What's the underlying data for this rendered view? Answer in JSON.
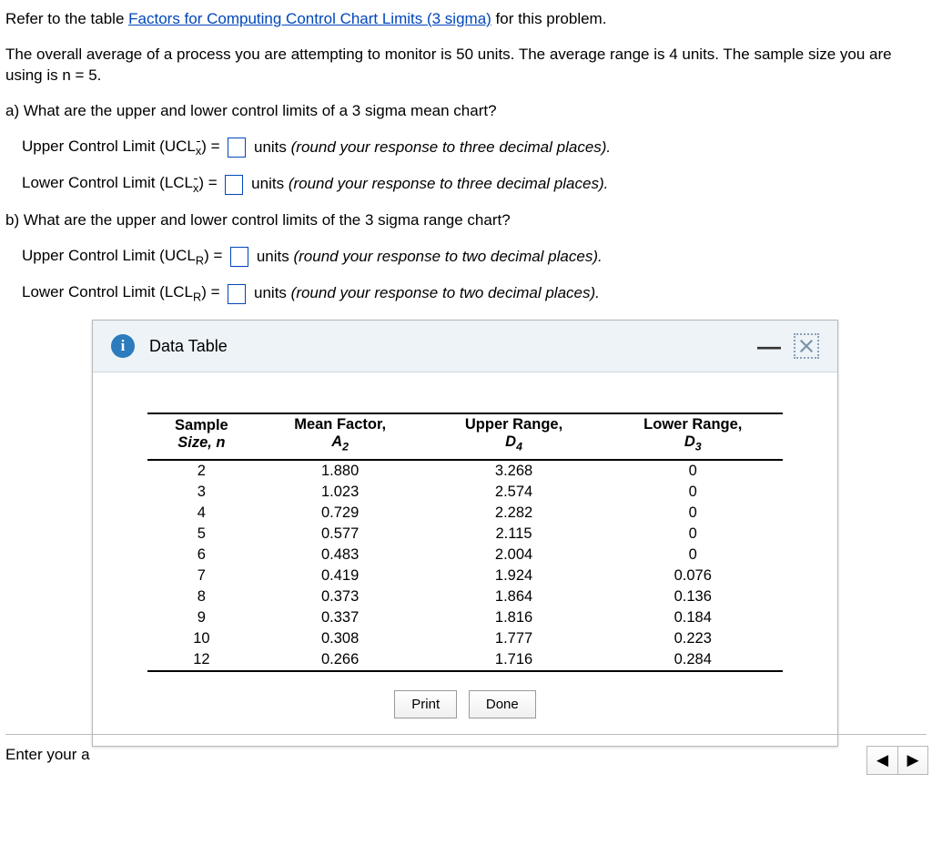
{
  "intro": {
    "refer_pre": "Refer to the table ",
    "refer_link": "Factors for Computing Control Chart Limits (3 sigma)",
    "refer_post": " for this problem.",
    "setup": "The overall average of a process you are attempting to monitor is 50 units. The average range is 4 units. The sample size you are using is n = 5."
  },
  "partA": {
    "prompt": "a) What are the upper and lower control limits of a 3 sigma mean chart?",
    "ucl_label_pre": "Upper Control Limit (UCL",
    "lcl_label_pre": "Lower Control Limit (LCL",
    "sub": "x",
    "label_post": ") = ",
    "units_text": " units ",
    "round_text": "(round your response to three decimal places)."
  },
  "partB": {
    "prompt": "b) What are the upper and lower control limits of the 3 sigma range chart?",
    "ucl_label_pre": "Upper Control Limit (UCL",
    "lcl_label_pre": "Lower Control Limit (LCL",
    "sub": "R",
    "label_post": ") = ",
    "units_text": " units ",
    "round_text": "(round your response to two decimal places)."
  },
  "modal": {
    "title": "Data Table",
    "info_glyph": "i",
    "minimize_glyph": "—",
    "print": "Print",
    "done": "Done",
    "headers": {
      "h1a": "Sample",
      "h1b": "Size, n",
      "h2a": "Mean Factor,",
      "h2b": "A",
      "h2sub": "2",
      "h3a": "Upper Range,",
      "h3b": "D",
      "h3sub": "4",
      "h4a": "Lower Range,",
      "h4b": "D",
      "h4sub": "3"
    },
    "rows": [
      {
        "n": "2",
        "a2": "1.880",
        "d4": "3.268",
        "d3": "0"
      },
      {
        "n": "3",
        "a2": "1.023",
        "d4": "2.574",
        "d3": "0"
      },
      {
        "n": "4",
        "a2": "0.729",
        "d4": "2.282",
        "d3": "0"
      },
      {
        "n": "5",
        "a2": "0.577",
        "d4": "2.115",
        "d3": "0"
      },
      {
        "n": "6",
        "a2": "0.483",
        "d4": "2.004",
        "d3": "0"
      },
      {
        "n": "7",
        "a2": "0.419",
        "d4": "1.924",
        "d3": "0.076"
      },
      {
        "n": "8",
        "a2": "0.373",
        "d4": "1.864",
        "d3": "0.136"
      },
      {
        "n": "9",
        "a2": "0.337",
        "d4": "1.816",
        "d3": "0.184"
      },
      {
        "n": "10",
        "a2": "0.308",
        "d4": "1.777",
        "d3": "0.223"
      },
      {
        "n": "12",
        "a2": "0.266",
        "d4": "1.716",
        "d3": "0.284"
      }
    ]
  },
  "footer": {
    "enter": "Enter your a",
    "prev": "◀",
    "next": "▶"
  },
  "chart_data": {
    "type": "table",
    "title": "Factors for Computing Control Chart Limits (3 sigma)",
    "columns": [
      "Sample Size n",
      "Mean Factor A2",
      "Upper Range D4",
      "Lower Range D3"
    ],
    "rows": [
      [
        2,
        1.88,
        3.268,
        0
      ],
      [
        3,
        1.023,
        2.574,
        0
      ],
      [
        4,
        0.729,
        2.282,
        0
      ],
      [
        5,
        0.577,
        2.115,
        0
      ],
      [
        6,
        0.483,
        2.004,
        0
      ],
      [
        7,
        0.419,
        1.924,
        0.076
      ],
      [
        8,
        0.373,
        1.864,
        0.136
      ],
      [
        9,
        0.337,
        1.816,
        0.184
      ],
      [
        10,
        0.308,
        1.777,
        0.223
      ],
      [
        12,
        0.266,
        1.716,
        0.284
      ]
    ]
  }
}
